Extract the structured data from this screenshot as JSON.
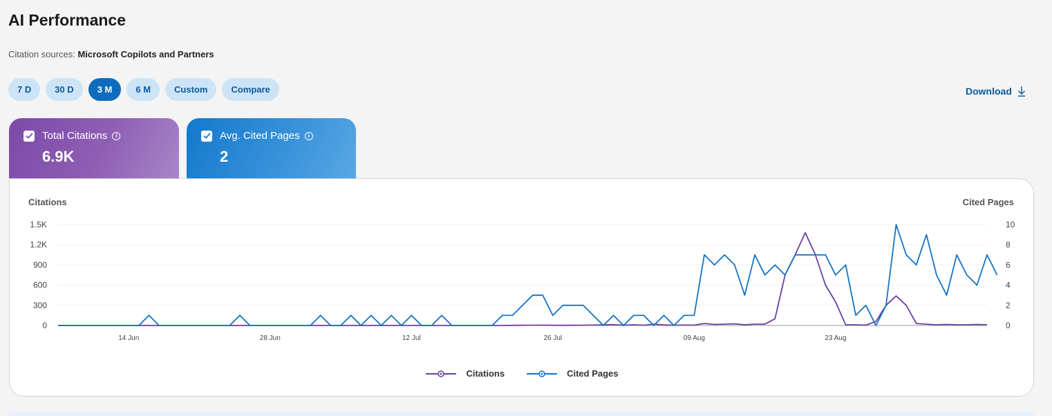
{
  "header": {
    "title": "AI Performance",
    "sources_label": "Citation sources:",
    "sources_value": "Microsoft Copilots and Partners"
  },
  "ranges": [
    {
      "label": "7 D",
      "active": false
    },
    {
      "label": "30 D",
      "active": false
    },
    {
      "label": "3 M",
      "active": true
    },
    {
      "label": "6 M",
      "active": false
    },
    {
      "label": "Custom",
      "active": false
    },
    {
      "label": "Compare",
      "active": false
    }
  ],
  "download_label": "Download",
  "cards": {
    "citations": {
      "label": "Total Citations",
      "value": "6.9K",
      "color": "#7b4aa8",
      "checked": true
    },
    "pages": {
      "label": "Avg. Cited Pages",
      "value": "2",
      "color": "#1279cc",
      "checked": true
    }
  },
  "chart_data": {
    "type": "line",
    "y_left_label": "Citations",
    "y_right_label": "Cited Pages",
    "y_left_ticks": [
      "0",
      "300",
      "600",
      "900",
      "1.2K",
      "1.5K"
    ],
    "y_right_ticks": [
      "0",
      "2",
      "4",
      "6",
      "8",
      "10"
    ],
    "ylim_left": [
      0,
      1500
    ],
    "ylim_right": [
      0,
      10
    ],
    "x_tick_labels": [
      {
        "index": 7,
        "label": "14 Jun"
      },
      {
        "index": 21,
        "label": "28 Jun"
      },
      {
        "index": 35,
        "label": "12 Jul"
      },
      {
        "index": 49,
        "label": "26 Jul"
      },
      {
        "index": 63,
        "label": "09 Aug"
      },
      {
        "index": 77,
        "label": "23 Aug"
      }
    ],
    "grid": true,
    "series": [
      {
        "name": "Citations",
        "axis": "left",
        "color": "#6b3fa0",
        "values": [
          0,
          0,
          0,
          0,
          0,
          0,
          0,
          0,
          0,
          0,
          0,
          0,
          0,
          0,
          0,
          0,
          0,
          0,
          0,
          0,
          0,
          0,
          0,
          0,
          0,
          0,
          0,
          0,
          0,
          0,
          0,
          0,
          0,
          0,
          0,
          0,
          0,
          0,
          0,
          0,
          0,
          0,
          0,
          0,
          0,
          2,
          3,
          4,
          5,
          3,
          2,
          3,
          4,
          6,
          8,
          12,
          5,
          10,
          4,
          20,
          8,
          4,
          6,
          5,
          30,
          15,
          20,
          25,
          10,
          20,
          20,
          100,
          750,
          1050,
          1380,
          1050,
          600,
          350,
          10,
          10,
          5,
          60,
          300,
          440,
          300,
          30,
          20,
          10,
          15,
          10,
          10,
          15,
          10
        ]
      },
      {
        "name": "Cited Pages",
        "axis": "right",
        "color": "#1273c6",
        "values": [
          0,
          0,
          0,
          0,
          0,
          0,
          0,
          0,
          0,
          1,
          0,
          0,
          0,
          0,
          0,
          0,
          0,
          0,
          1,
          0,
          0,
          0,
          0,
          0,
          0,
          0,
          1,
          0,
          0,
          1,
          0,
          1,
          0,
          1,
          0,
          1,
          0,
          0,
          1,
          0,
          0,
          0,
          0,
          0,
          1,
          1,
          2,
          3,
          3,
          1,
          2,
          2,
          2,
          1,
          0,
          1,
          0,
          1,
          1,
          0,
          1,
          0,
          1,
          1,
          7,
          6,
          7,
          6,
          3,
          7,
          5,
          6,
          5,
          7,
          7,
          7,
          7,
          5,
          6,
          1,
          2,
          0,
          2,
          10,
          7,
          6,
          9,
          5,
          3,
          7,
          5,
          4,
          7,
          5
        ]
      }
    ]
  }
}
